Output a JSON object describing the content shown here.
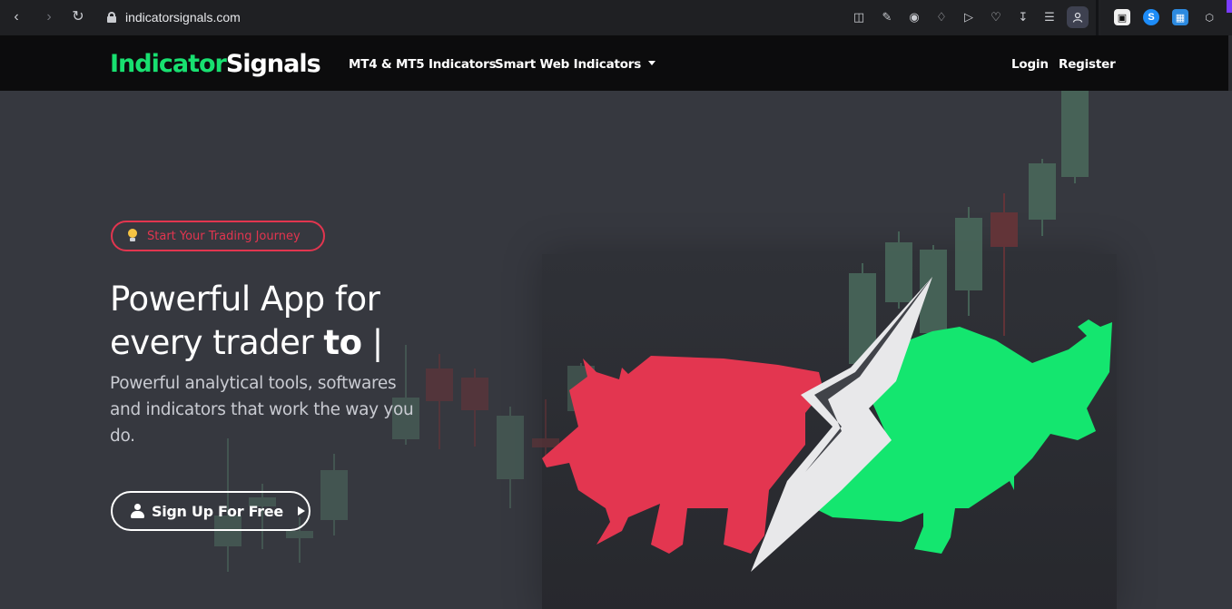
{
  "browser": {
    "url": "indicatorsignals.com",
    "extensions": [
      "zoom-ext-icon",
      "shazam-icon",
      "translate-ext-icon",
      "cube-icon"
    ]
  },
  "nav": {
    "logo_part1": "Indicator",
    "logo_part2": "Signals",
    "links": [
      {
        "label": "MT4 & MT5 Indicators"
      },
      {
        "label": "Smart Web Indicators"
      }
    ],
    "login": "Login",
    "register": "Register"
  },
  "hero": {
    "badge": "Start Your Trading Journey",
    "headline_line1": "Powerful App for",
    "headline_line2_prefix": "every trader ",
    "headline_line2_bold": "to",
    "headline_cursor": " |",
    "subtitle": "Powerful analytical tools, softwares and indicators that work the way you do.",
    "cta": "Sign Up For Free"
  },
  "colors": {
    "accent_green": "#18e070",
    "accent_red": "#e2354f",
    "nav_bg": "#0c0c0d",
    "hero_bg": "#36383f"
  }
}
